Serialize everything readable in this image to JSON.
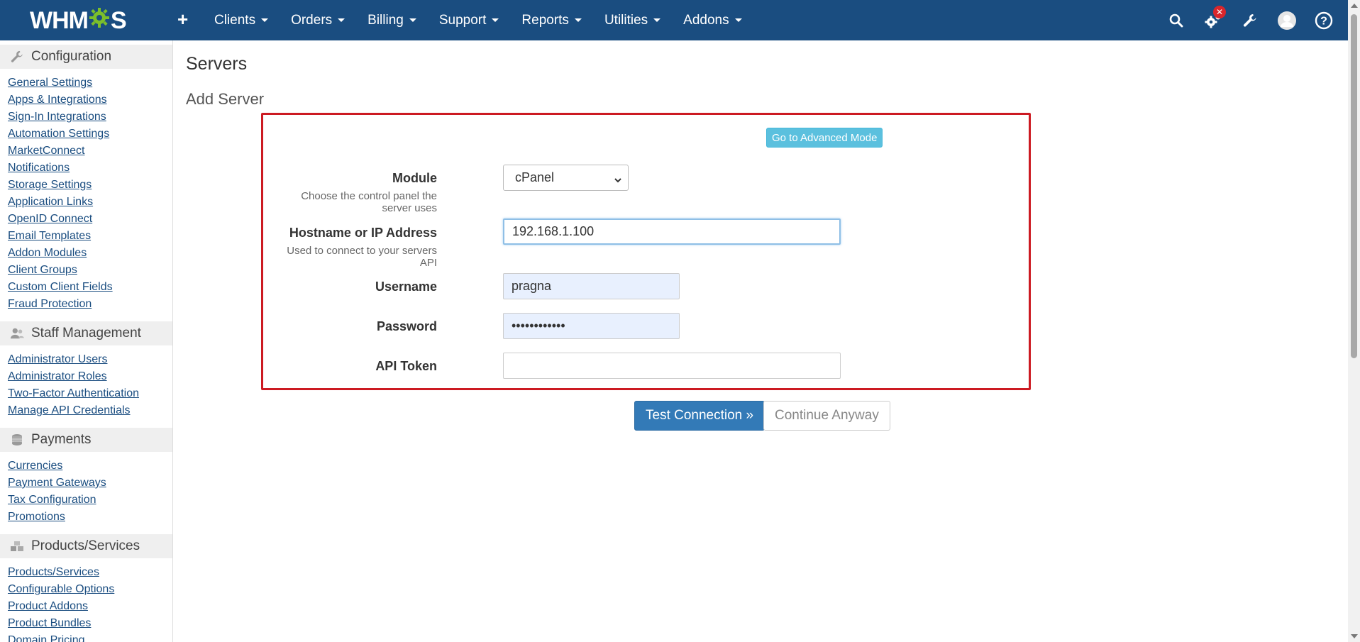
{
  "navbar": {
    "logo_text_left": "WHM",
    "logo_text_right": "S",
    "items": [
      {
        "label": "Clients"
      },
      {
        "label": "Orders"
      },
      {
        "label": "Billing"
      },
      {
        "label": "Support"
      },
      {
        "label": "Reports"
      },
      {
        "label": "Utilities"
      },
      {
        "label": "Addons"
      }
    ],
    "right_icons": [
      "search-icon",
      "gears-icon",
      "wrench-icon",
      "avatar",
      "help-icon"
    ],
    "alert_badge": "✕",
    "brand_color": "#1a4d80"
  },
  "sidebar": {
    "sections": [
      {
        "title": "Configuration",
        "icon": "wrench-icon",
        "links": [
          "General Settings",
          "Apps & Integrations",
          "Sign-In Integrations",
          "Automation Settings",
          "MarketConnect",
          "Notifications",
          "Storage Settings",
          "Application Links",
          "OpenID Connect",
          "Email Templates",
          "Addon Modules",
          "Client Groups",
          "Custom Client Fields",
          "Fraud Protection"
        ]
      },
      {
        "title": "Staff Management",
        "icon": "users-icon",
        "links": [
          "Administrator Users",
          "Administrator Roles",
          "Two-Factor Authentication",
          "Manage API Credentials"
        ]
      },
      {
        "title": "Payments",
        "icon": "coins-icon",
        "links": [
          "Currencies",
          "Payment Gateways",
          "Tax Configuration",
          "Promotions"
        ]
      },
      {
        "title": "Products/Services",
        "icon": "cubes-icon",
        "links": [
          "Products/Services",
          "Configurable Options",
          "Product Addons",
          "Product Bundles",
          "Domain Pricing"
        ]
      }
    ]
  },
  "main": {
    "title": "Servers",
    "subtitle": "Add Server",
    "advanced_mode_label": "Go to Advanced Mode",
    "module": {
      "label": "Module",
      "help": "Choose the control panel the server uses",
      "value": "cPanel"
    },
    "hostname": {
      "label": "Hostname or IP Address",
      "help": "Used to connect to your servers API",
      "value": "192.168.1.100"
    },
    "username": {
      "label": "Username",
      "value": "pragna"
    },
    "password": {
      "label": "Password",
      "value": "••••••••••••"
    },
    "api_token": {
      "label": "API Token",
      "value": ""
    },
    "test_button": "Test Connection »",
    "continue_button": "Continue Anyway"
  }
}
